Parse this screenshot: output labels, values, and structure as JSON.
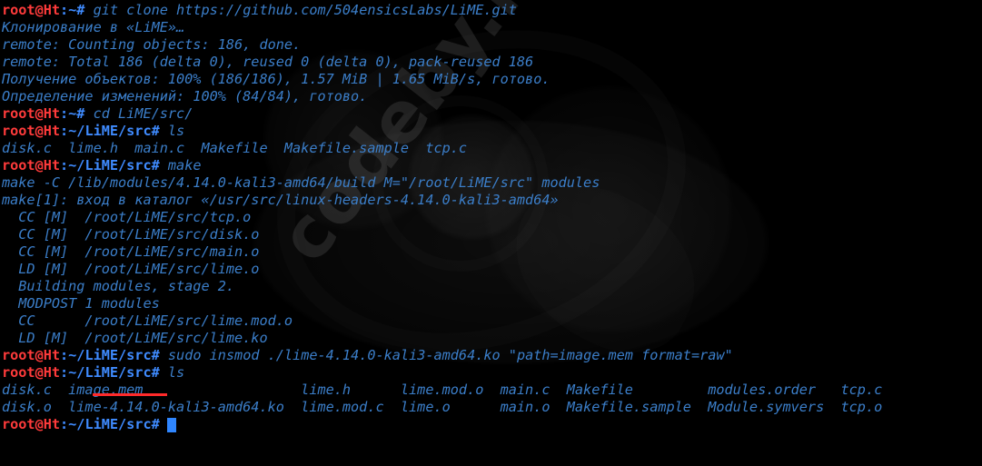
{
  "terminal": {
    "background_color": "#000000",
    "prompt_user_color": "#ff3b3b",
    "prompt_path_color": "#3f8bff",
    "text_color": "#3b7ec9",
    "cursor_color": "#2f86ff",
    "watermark": "codeby.net",
    "lines": [
      {
        "type": "prompt",
        "user": "root@Ht",
        "path": ":~#",
        "cmd": "git clone https://github.com/504ensicsLabs/LiME.git"
      },
      {
        "type": "output",
        "text": "Клонирование в «LiME»…"
      },
      {
        "type": "output",
        "text": "remote: Counting objects: 186, done."
      },
      {
        "type": "output",
        "text": "remote: Total 186 (delta 0), reused 0 (delta 0), pack-reused 186"
      },
      {
        "type": "output",
        "text": "Получение объектов: 100% (186/186), 1.57 MiB | 1.65 MiB/s, готово."
      },
      {
        "type": "output",
        "text": "Определение изменений: 100% (84/84), готово."
      },
      {
        "type": "prompt",
        "user": "root@Ht",
        "path": ":~#",
        "cmd": "cd LiME/src/"
      },
      {
        "type": "prompt",
        "user": "root@Ht",
        "path": ":~/LiME/src#",
        "cmd": "ls"
      },
      {
        "type": "output",
        "text": "disk.c  lime.h  main.c  Makefile  Makefile.sample  tcp.c"
      },
      {
        "type": "prompt",
        "user": "root@Ht",
        "path": ":~/LiME/src#",
        "cmd": "make"
      },
      {
        "type": "output",
        "text": "make -C /lib/modules/4.14.0-kali3-amd64/build M=\"/root/LiME/src\" modules"
      },
      {
        "type": "output",
        "text": "make[1]: вход в каталог «/usr/src/linux-headers-4.14.0-kali3-amd64»"
      },
      {
        "type": "output",
        "text": "  CC [M]  /root/LiME/src/tcp.o"
      },
      {
        "type": "output",
        "text": "  CC [M]  /root/LiME/src/disk.o"
      },
      {
        "type": "output",
        "text": "  CC [M]  /root/LiME/src/main.o"
      },
      {
        "type": "output",
        "text": "  LD [M]  /root/LiME/src/lime.o"
      },
      {
        "type": "output",
        "text": "  Building modules, stage 2."
      },
      {
        "type": "output",
        "text": "  MODPOST 1 modules"
      },
      {
        "type": "output",
        "text": "  CC      /root/LiME/src/lime.mod.o"
      },
      {
        "type": "output",
        "text": "  LD [M]  /root/LiME/src/lime.ko"
      },
      {
        "type": "prompt",
        "user": "root@Ht",
        "path": ":~/LiME/src#",
        "cmd": "sudo insmod ./lime-4.14.0-kali3-amd64.ko \"path=image.mem format=raw\""
      },
      {
        "type": "prompt",
        "user": "root@Ht",
        "path": ":~/LiME/src#",
        "cmd": "ls"
      },
      {
        "type": "output",
        "text": "disk.c  image.mem                   lime.h      lime.mod.o  main.c  Makefile         modules.order   tcp.c"
      },
      {
        "type": "output",
        "text": "disk.o  lime-4.14.0-kali3-amd64.ko  lime.mod.c  lime.o      main.o  Makefile.sample  Module.symvers  tcp.o"
      },
      {
        "type": "prompt-cursor",
        "user": "root@Ht",
        "path": ":~/LiME/src#",
        "cmd": ""
      }
    ]
  }
}
